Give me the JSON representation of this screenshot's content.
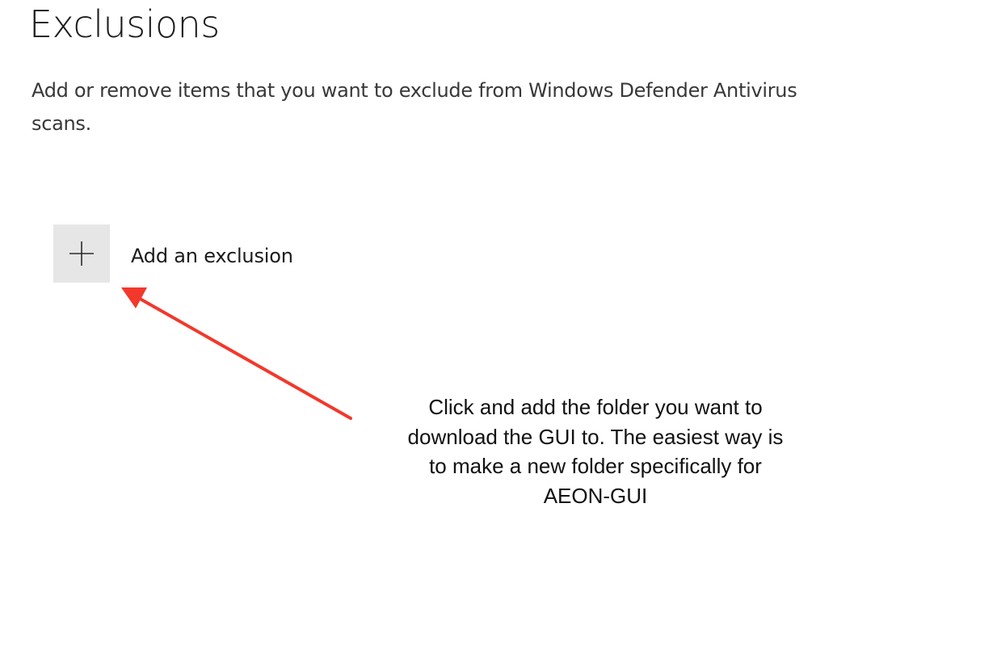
{
  "page": {
    "title": "Exclusions",
    "description": "Add or remove items that you want to exclude from Windows Defender Antivirus scans."
  },
  "add_exclusion": {
    "icon": "plus-icon",
    "label": "Add an exclusion"
  },
  "annotation": {
    "text": "Click and add the folder you want to\ndownload the GUI to. The easiest way is\nto make a new folder specifically for\nAEON-GUI",
    "arrow_color": "#f2382b"
  }
}
